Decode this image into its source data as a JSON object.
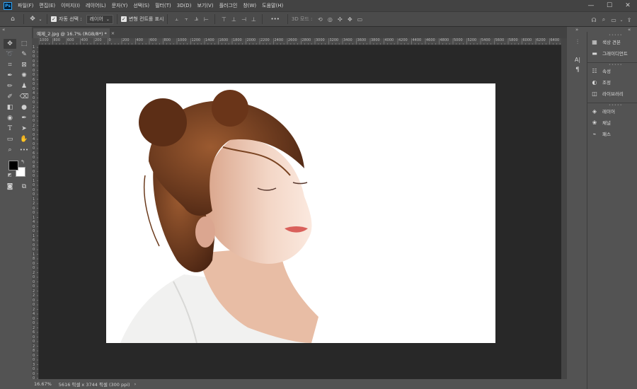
{
  "menubar": {
    "logo": "Ps",
    "items": [
      "파일(F)",
      "편집(E)",
      "이미지(I)",
      "레이어(L)",
      "문자(Y)",
      "선택(S)",
      "필터(T)",
      "3D(D)",
      "보기(V)",
      "플러그인",
      "창(W)",
      "도움말(H)"
    ],
    "window_controls": [
      "—",
      "☐",
      "✕"
    ]
  },
  "options": {
    "auto_select_label": "자동 선택 :",
    "auto_select_value": "레이어",
    "transform_controls_label": "변형 컨트롤 표시",
    "more": "•••",
    "mode3d_label": "3D 모드 :"
  },
  "document": {
    "tab_title": "예제_2.jpg @ 16.7% (RGB/8*) *",
    "tab_close": "×"
  },
  "ruler": {
    "h_labels": [
      "1000",
      "800",
      "600",
      "400",
      "200",
      "0",
      "200",
      "400",
      "600",
      "800",
      "1000",
      "1200",
      "1400",
      "1600",
      "1800",
      "2000",
      "2200",
      "2400",
      "2600",
      "2800",
      "3000",
      "3200",
      "3400",
      "3600",
      "3800",
      "4000",
      "4200",
      "4400",
      "4600",
      "4800",
      "5000",
      "5200",
      "5400",
      "5600",
      "5800",
      "6000",
      "6200",
      "6400"
    ],
    "v_labels": [
      "1",
      "0",
      "0",
      "0",
      "8",
      "0",
      "0",
      "6",
      "0",
      "0",
      "4",
      "0",
      "0",
      "2",
      "0",
      "0",
      "0",
      "2",
      "0",
      "0",
      "4",
      "0",
      "0",
      "6",
      "0",
      "0",
      "8",
      "0",
      "0",
      "1",
      "0",
      "0",
      "0",
      "1",
      "2",
      "0",
      "0",
      "1",
      "4",
      "0",
      "0",
      "1",
      "6",
      "0",
      "0",
      "1",
      "8",
      "0",
      "0",
      "2",
      "0",
      "0",
      "0",
      "2",
      "2",
      "0",
      "0",
      "2",
      "4",
      "0",
      "0",
      "2",
      "6",
      "0",
      "0",
      "2",
      "8",
      "0",
      "0",
      "3",
      "0",
      "0",
      "0"
    ]
  },
  "status": {
    "zoom": "16.67%",
    "info": "5616 픽셀 x 3744 픽셀 (300 ppi)",
    "arrow": "›"
  },
  "panels": {
    "group1": [
      "색상 견본",
      "그레이디언트"
    ],
    "group2": [
      "속성",
      "조정",
      "라이브러리"
    ],
    "group3": [
      "레이어",
      "채널",
      "패스"
    ]
  },
  "colors": {
    "foreground": "#000000",
    "background": "#ffffff",
    "accent": "#31a8ff"
  }
}
